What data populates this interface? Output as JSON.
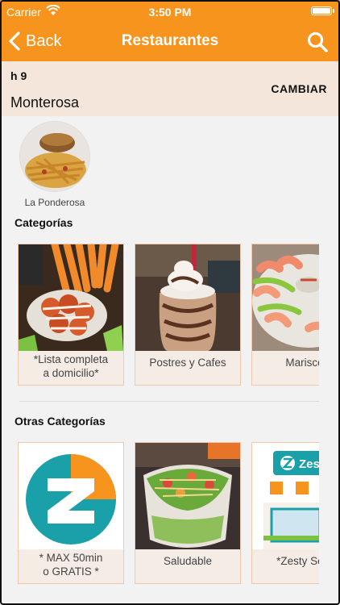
{
  "status_bar": {
    "carrier": "Carrier",
    "time": "3:50 PM"
  },
  "nav": {
    "back_label": "Back",
    "title": "Restaurantes"
  },
  "location": {
    "code": "h 9",
    "name": "Monterosa",
    "change_label": "CAMBIAR"
  },
  "featured": [
    {
      "label": "La Ponderosa"
    }
  ],
  "sections": {
    "categories_title": "Categorías",
    "other_title": "Otras Categorías"
  },
  "categories": [
    {
      "label": "*Lista completa\na domicilio*"
    },
    {
      "label": "Postres y Cafes"
    },
    {
      "label": "Marisco"
    }
  ],
  "other_categories": [
    {
      "label": "* MAX 50min\no GRATIS *"
    },
    {
      "label": "Saludable"
    },
    {
      "label": "*Zesty Serv"
    }
  ],
  "logo_text": {
    "zesty": "Zesty"
  },
  "colors": {
    "brand_orange": "#f7941e",
    "header_band": "#f5e6dc",
    "card_border": "#f2c7ae",
    "teal": "#1aa0a8"
  }
}
